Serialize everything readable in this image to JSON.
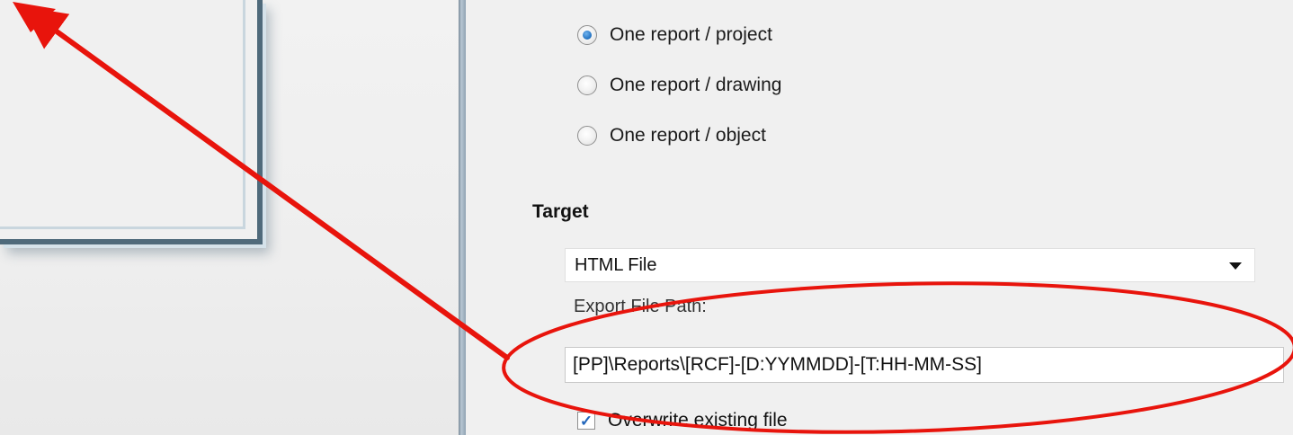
{
  "report_type": {
    "options": [
      {
        "label": "One report / project",
        "checked": true
      },
      {
        "label": "One report / drawing",
        "checked": false
      },
      {
        "label": "One report / object",
        "checked": false
      }
    ]
  },
  "target": {
    "heading": "Target",
    "selected": "HTML File",
    "path_label": "Export File Path:",
    "path_value": "[PP]\\Reports\\[RCF]-[D:YYMMDD]-[T:HH-MM-SS]",
    "overwrite_label": "Overwrite existing file",
    "overwrite_checked": true
  },
  "annotation": {
    "color": "#e8140c"
  },
  "icons": [
    "radio-selected-icon",
    "radio-icon",
    "dropdown-arrow-icon",
    "checkmark-icon"
  ]
}
